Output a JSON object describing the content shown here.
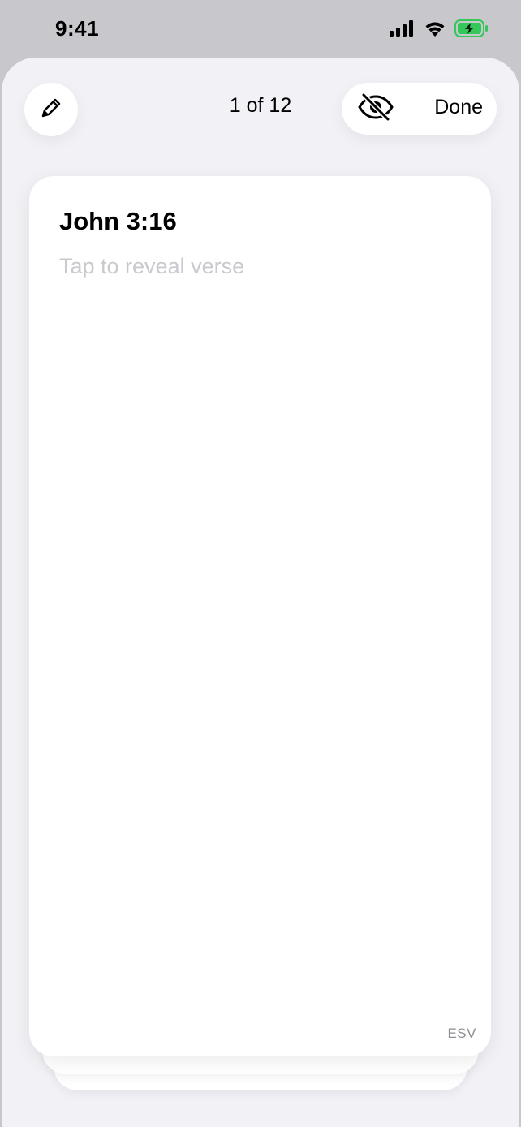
{
  "status_bar": {
    "time": "9:41",
    "icons": [
      "cellular-signal-icon",
      "wifi-icon",
      "battery-charging-icon"
    ],
    "battery_color": "#34c759"
  },
  "toolbar": {
    "edit_icon": "pencil-icon",
    "counter": "1 of 12",
    "hide_icon": "eye-slash-icon",
    "done_label": "Done"
  },
  "card": {
    "reference": "John 3:16",
    "hint": "Tap to reveal verse",
    "translation": "ESV"
  },
  "colors": {
    "sheet_background": "#f1f1f6",
    "card_background": "#ffffff",
    "hint_text": "#c9c9ce",
    "translation_text": "#8e8e93"
  }
}
